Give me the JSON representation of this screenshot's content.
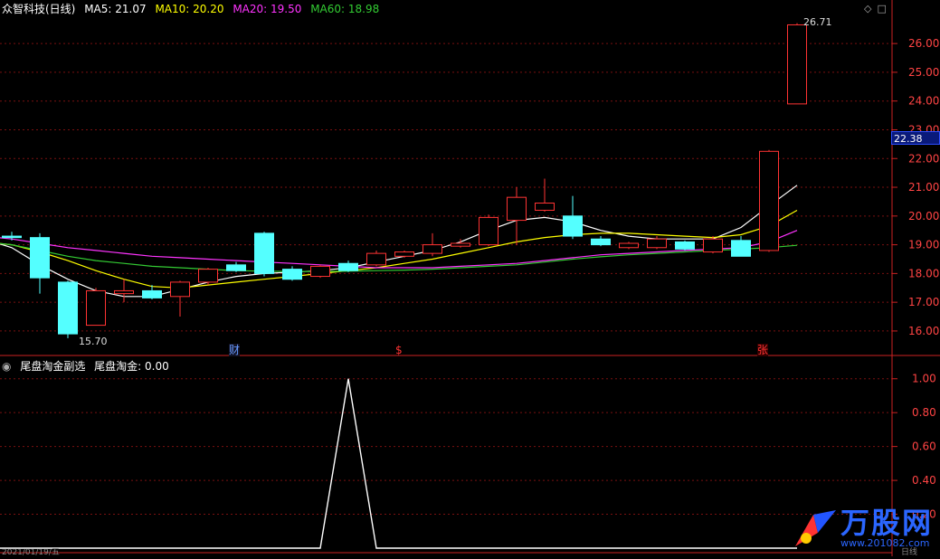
{
  "header": {
    "stock_name": "众智科技(日线)",
    "ma5_label": "MA5: 21.07",
    "ma10_label": "MA10: 20.20",
    "ma20_label": "MA20: 19.50",
    "ma60_label": "MA60: 18.98",
    "colors": {
      "ma5": "#ffffff",
      "ma10": "#ffff00",
      "ma20": "#ff33ff",
      "ma60": "#33cc33"
    }
  },
  "indicator_header": {
    "pane_title": "尾盘淘金副选",
    "value_label": "尾盘淘金: 0.00"
  },
  "price_badge": "22.38",
  "markers": {
    "cai": "财",
    "dollar": "$",
    "zhang": "张"
  },
  "annotations": {
    "high": "26.71",
    "low": "15.70"
  },
  "watermark": {
    "brand": "万股网",
    "url": "www.201082.com"
  },
  "bottom_labels": {
    "date": "2021/01/19/五",
    "right": "日线"
  },
  "chart_data": [
    {
      "type": "candlestick",
      "title": "众智科技(日线)",
      "ylim": [
        15.4,
        27.2
      ],
      "yticks": [
        16.0,
        17.0,
        18.0,
        19.0,
        20.0,
        21.0,
        22.0,
        23.0,
        24.0,
        25.0,
        26.0
      ],
      "candles": [
        {
          "o": 19.3,
          "h": 19.45,
          "l": 19.15,
          "c": 19.25
        },
        {
          "o": 19.25,
          "h": 19.4,
          "l": 17.3,
          "c": 17.85
        },
        {
          "o": 17.7,
          "h": 17.75,
          "l": 15.75,
          "c": 15.9
        },
        {
          "o": 16.2,
          "h": 17.5,
          "l": 16.2,
          "c": 17.4
        },
        {
          "o": 17.3,
          "h": 17.8,
          "l": 17.0,
          "c": 17.4
        },
        {
          "o": 17.4,
          "h": 17.6,
          "l": 17.1,
          "c": 17.15
        },
        {
          "o": 17.2,
          "h": 17.75,
          "l": 16.5,
          "c": 17.7
        },
        {
          "o": 17.7,
          "h": 18.2,
          "l": 17.6,
          "c": 18.15
        },
        {
          "o": 18.3,
          "h": 18.4,
          "l": 18.05,
          "c": 18.1
        },
        {
          "o": 19.4,
          "h": 19.45,
          "l": 17.9,
          "c": 18.0
        },
        {
          "o": 18.15,
          "h": 18.25,
          "l": 17.75,
          "c": 17.8
        },
        {
          "o": 17.9,
          "h": 18.3,
          "l": 17.85,
          "c": 18.25
        },
        {
          "o": 18.35,
          "h": 18.45,
          "l": 18.05,
          "c": 18.1
        },
        {
          "o": 18.3,
          "h": 18.8,
          "l": 18.25,
          "c": 18.7
        },
        {
          "o": 18.6,
          "h": 18.8,
          "l": 18.55,
          "c": 18.75
        },
        {
          "o": 18.7,
          "h": 19.4,
          "l": 18.6,
          "c": 19.0
        },
        {
          "o": 18.95,
          "h": 19.2,
          "l": 18.9,
          "c": 19.05
        },
        {
          "o": 19.0,
          "h": 20.05,
          "l": 18.95,
          "c": 19.95
        },
        {
          "o": 19.85,
          "h": 21.0,
          "l": 19.0,
          "c": 20.65
        },
        {
          "o": 20.2,
          "h": 21.3,
          "l": 20.15,
          "c": 20.45
        },
        {
          "o": 20.0,
          "h": 20.7,
          "l": 19.2,
          "c": 19.3
        },
        {
          "o": 19.2,
          "h": 19.3,
          "l": 18.95,
          "c": 19.0
        },
        {
          "o": 18.9,
          "h": 19.1,
          "l": 18.85,
          "c": 19.05
        },
        {
          "o": 18.9,
          "h": 19.3,
          "l": 18.85,
          "c": 19.2
        },
        {
          "o": 19.1,
          "h": 19.15,
          "l": 18.8,
          "c": 18.85
        },
        {
          "o": 18.75,
          "h": 19.3,
          "l": 18.7,
          "c": 19.2
        },
        {
          "o": 19.15,
          "h": 19.3,
          "l": 18.6,
          "c": 18.6
        },
        {
          "o": 18.8,
          "h": 22.3,
          "l": 18.75,
          "c": 22.25
        },
        {
          "o": 23.9,
          "h": 26.71,
          "l": 23.9,
          "c": 26.65
        }
      ],
      "series": [
        {
          "name": "MA5",
          "values": [
            19.2,
            18.9,
            18.3,
            17.8,
            17.4,
            17.2,
            17.2,
            17.45,
            17.7,
            17.9,
            18.0,
            18.05,
            18.1,
            18.2,
            18.4,
            18.6,
            18.8,
            19.1,
            19.5,
            19.85,
            19.95,
            19.8,
            19.5,
            19.3,
            19.2,
            19.2,
            19.2,
            19.6,
            20.35,
            21.07
          ]
        },
        {
          "name": "MA10",
          "values": [
            19.1,
            19.0,
            18.75,
            18.45,
            18.1,
            17.8,
            17.55,
            17.5,
            17.6,
            17.7,
            17.8,
            17.9,
            18.0,
            18.1,
            18.2,
            18.35,
            18.5,
            18.7,
            18.9,
            19.1,
            19.25,
            19.35,
            19.4,
            19.4,
            19.35,
            19.3,
            19.25,
            19.35,
            19.65,
            20.2
          ]
        },
        {
          "name": "MA20",
          "values": [
            19.3,
            19.2,
            19.05,
            18.9,
            18.8,
            18.7,
            18.6,
            18.55,
            18.5,
            18.45,
            18.4,
            18.35,
            18.3,
            18.25,
            18.2,
            18.2,
            18.2,
            18.25,
            18.3,
            18.35,
            18.45,
            18.55,
            18.65,
            18.7,
            18.75,
            18.8,
            18.85,
            18.9,
            19.1,
            19.5
          ]
        },
        {
          "name": "MA60",
          "values": [
            19.1,
            19.0,
            18.8,
            18.6,
            18.45,
            18.35,
            18.25,
            18.2,
            18.15,
            18.1,
            18.08,
            18.07,
            18.07,
            18.08,
            18.1,
            18.12,
            18.15,
            18.2,
            18.25,
            18.3,
            18.4,
            18.5,
            18.58,
            18.65,
            18.7,
            18.75,
            18.8,
            18.85,
            18.9,
            18.98
          ]
        }
      ]
    },
    {
      "type": "line",
      "title": "尾盘淘金副选",
      "ylim": [
        0,
        1.1
      ],
      "yticks": [
        0.2,
        0.4,
        0.6,
        0.8,
        1.0
      ],
      "series": [
        {
          "name": "尾盘淘金",
          "values": [
            0,
            0,
            0,
            0,
            0,
            0,
            0,
            0,
            0,
            0,
            0,
            0,
            0,
            1,
            0,
            0,
            0,
            0,
            0,
            0,
            0,
            0,
            0,
            0,
            0,
            0,
            0,
            0,
            0,
            0
          ]
        }
      ]
    }
  ]
}
